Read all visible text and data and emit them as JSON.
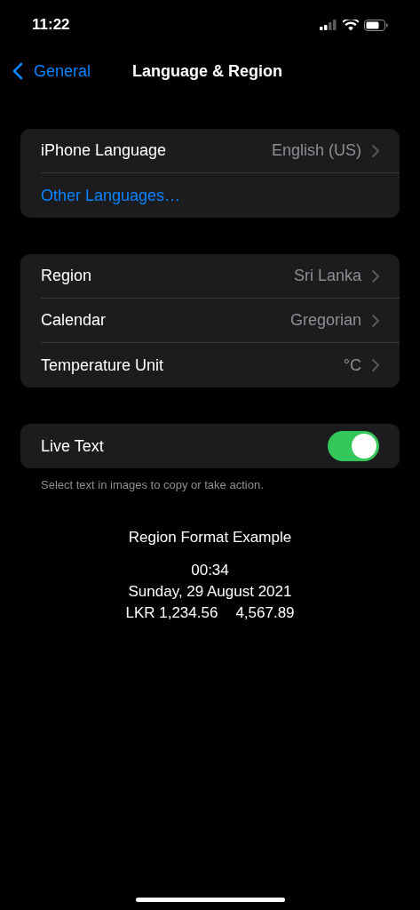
{
  "status_bar": {
    "time": "11:22"
  },
  "nav": {
    "back": "General",
    "title": "Language & Region"
  },
  "groups": [
    {
      "rows": [
        {
          "kind": "value",
          "label": "iPhone Language",
          "value": "English (US)"
        },
        {
          "kind": "link",
          "label": "Other Languages…"
        }
      ]
    },
    {
      "rows": [
        {
          "kind": "value",
          "label": "Region",
          "value": "Sri Lanka"
        },
        {
          "kind": "value",
          "label": "Calendar",
          "value": "Gregorian"
        },
        {
          "kind": "value",
          "label": "Temperature Unit",
          "value": "°C"
        }
      ]
    },
    {
      "rows": [
        {
          "kind": "toggle",
          "label": "Live Text",
          "on": true
        }
      ],
      "footer": "Select text in images to copy or take action."
    }
  ],
  "example": {
    "title": "Region Format Example",
    "time": "00:34",
    "date": "Sunday, 29 August 2021",
    "currency": "LKR 1,234.56",
    "number": "4,567.89"
  }
}
